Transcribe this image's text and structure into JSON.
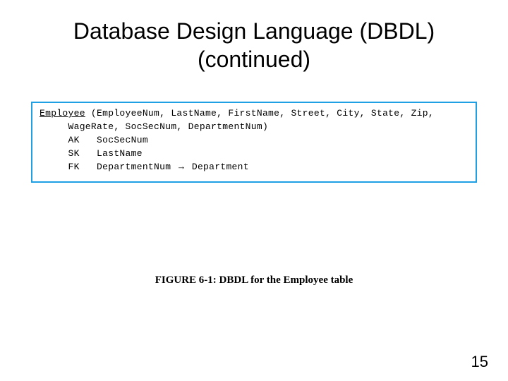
{
  "title_line1": "Database Design Language (DBDL)",
  "title_line2": "(continued)",
  "code": {
    "entity": "Employee",
    "attrs1": " (EmployeeNum, LastName, FirstName, Street, City, State, Zip,",
    "attrs2": "     WageRate, SocSecNum, DepartmentNum)",
    "ak": "     AK   SocSecNum",
    "sk": "     SK   LastName",
    "fk_pre": "     FK   DepartmentNum ",
    "fk_arrow": "→",
    "fk_post": " Department"
  },
  "caption": "FIGURE 6-1: DBDL for the Employee table",
  "page_number": "15"
}
